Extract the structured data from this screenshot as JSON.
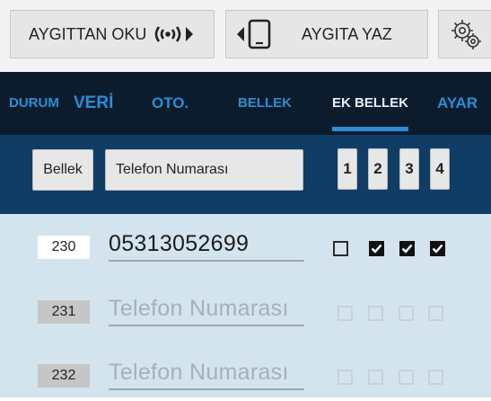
{
  "toolbar": {
    "read_label": "AYGITTAN OKU",
    "read_icon": "nfc-signal-icon",
    "write_label": "AYGITA YAZ",
    "write_icon": "phone-device-icon",
    "settings_icon": "gear-icon"
  },
  "tabs": [
    {
      "label": "DURUM",
      "active": false
    },
    {
      "label": "VERİ",
      "active": false
    },
    {
      "label": "OTO.",
      "active": false
    },
    {
      "label": "BELLEK",
      "active": false
    },
    {
      "label": "EK BELLEK",
      "active": true
    },
    {
      "label": "AYAR",
      "active": false
    }
  ],
  "header": {
    "bellek_label": "Bellek",
    "telefon_label": "Telefon Numarası",
    "columns": [
      "1",
      "2",
      "3",
      "4"
    ]
  },
  "rows": [
    {
      "index": "230",
      "value": "05313052699",
      "placeholder": "Telefon Numarası",
      "checks": [
        false,
        true,
        true,
        true
      ],
      "enabled": true
    },
    {
      "index": "231",
      "value": "",
      "placeholder": "Telefon Numarası",
      "checks": [
        false,
        false,
        false,
        false
      ],
      "enabled": false
    },
    {
      "index": "232",
      "value": "",
      "placeholder": "Telefon Numarası",
      "checks": [
        false,
        false,
        false,
        false
      ],
      "enabled": false
    }
  ],
  "colors": {
    "toolbar_bg": "#f3f3f3",
    "tabbar_bg": "#0d1c2d",
    "tab_text": "#2a8fd6",
    "tab_active_text": "#e9f0f7",
    "header_bg": "#0f3d66",
    "content_bg": "#d3e4ee"
  }
}
